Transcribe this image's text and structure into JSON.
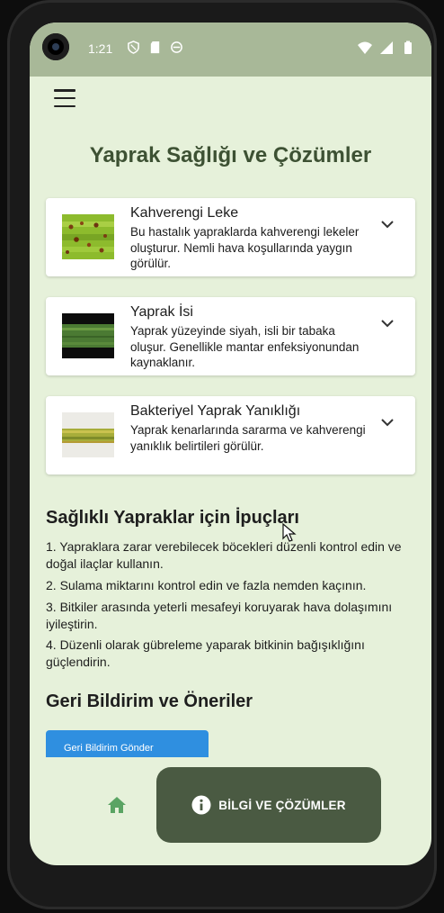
{
  "status_bar": {
    "time": "1:21",
    "left_icons": [
      "shield-icon",
      "sd-card-icon",
      "app-notification-icon"
    ],
    "right_icons": [
      "wifi-icon",
      "signal-icon",
      "battery-icon"
    ]
  },
  "header": {
    "menu_icon": "hamburger-menu-icon",
    "title": "Yaprak Sağlığı ve Çözümler"
  },
  "diseases": [
    {
      "title": "Kahverengi Leke",
      "description": "Bu hastalık yapraklarda kahverengi lekeler oluşturur. Nemli hava koşullarında yaygın görülür."
    },
    {
      "title": "Yaprak İsi",
      "description": "Yaprak yüzeyinde siyah, isli bir tabaka oluşur. Genellikle mantar enfeksiyonundan kaynaklanır."
    },
    {
      "title": "Bakteriyel Yaprak Yanıklığı",
      "description": "Yaprak kenarlarında sararma ve kahverengi yanıklık belirtileri görülür."
    }
  ],
  "tips": {
    "title": "Sağlıklı Yapraklar için İpuçları",
    "items": [
      "1. Yapraklara zarar verebilecek böcekleri düzenli kontrol edin ve doğal ilaçlar kullanın.",
      "2. Sulama miktarını kontrol edin ve fazla nemden kaçının.",
      "3. Bitkiler arasında yeterli mesafeyi koruyarak hava dolaşımını iyileştirin.",
      "4. Düzenli olarak gübreleme yaparak bitkinin bağışıklığını güçlendirin."
    ]
  },
  "feedback": {
    "title": "Geri Bildirim ve Öneriler",
    "button_label": "Geri Bildirim Gönder"
  },
  "bottom_nav": {
    "home_icon": "home-icon",
    "active_label": "BİLGİ VE ÇÖZÜMLER",
    "active_icon": "info-icon"
  },
  "colors": {
    "background": "#e6f1da",
    "title": "#3d5133",
    "nav_active": "#4a5a42",
    "home_icon": "#5aa463",
    "button": "#2f8fe0"
  }
}
